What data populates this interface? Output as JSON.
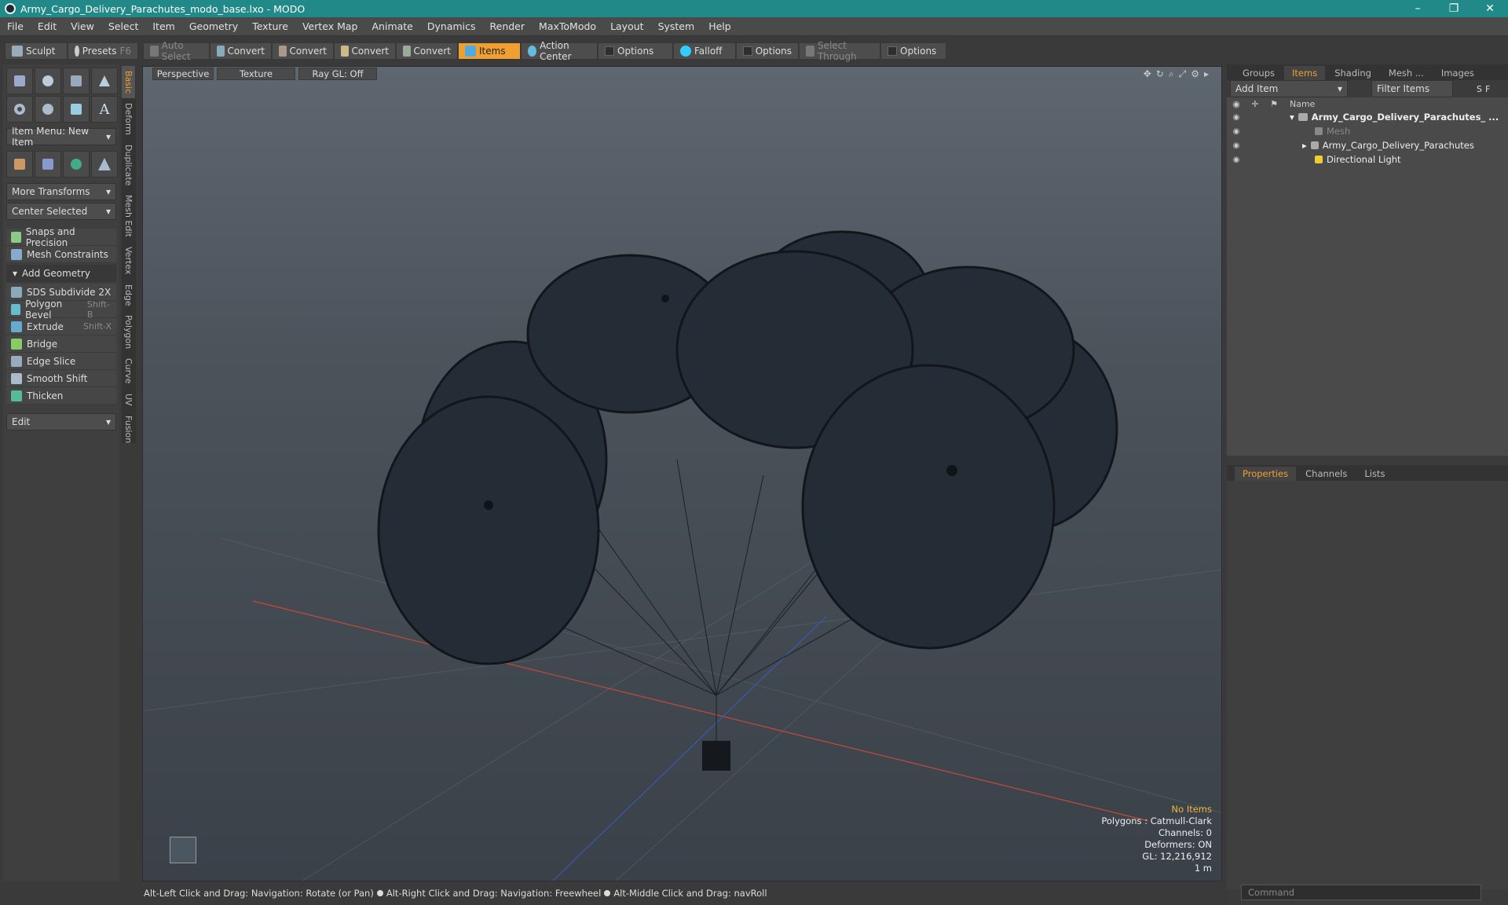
{
  "window": {
    "title": "Army_Cargo_Delivery_Parachutes_modo_base.lxo - MODO",
    "minimize": "–",
    "maximize": "❐",
    "close": "✕"
  },
  "menu": [
    "File",
    "Edit",
    "View",
    "Select",
    "Item",
    "Geometry",
    "Texture",
    "Vertex Map",
    "Animate",
    "Dynamics",
    "Render",
    "MaxToModo",
    "Layout",
    "System",
    "Help"
  ],
  "toolbar": {
    "sculpt": "Sculpt",
    "presets": "Presets",
    "presets_key": "F6",
    "auto_select": "Auto Select",
    "convert1": "Convert",
    "convert2": "Convert",
    "convert3": "Convert",
    "convert4": "Convert",
    "items": "Items",
    "action_center": "Action Center",
    "options1": "Options",
    "falloff": "Falloff",
    "options2": "Options",
    "select_through": "Select Through",
    "options3": "Options"
  },
  "left": {
    "item_menu": "Item Menu: New Item",
    "more_transforms": "More Transforms",
    "center_selected": "Center Selected",
    "snaps": "Snaps and Precision",
    "mesh_constraints": "Mesh Constraints",
    "add_geometry": "Add Geometry",
    "tools": [
      {
        "label": "SDS Subdivide 2X",
        "key": ""
      },
      {
        "label": "Polygon Bevel",
        "key": "Shift-B"
      },
      {
        "label": "Extrude",
        "key": "Shift-X"
      },
      {
        "label": "Bridge",
        "key": ""
      },
      {
        "label": "Edge Slice",
        "key": ""
      },
      {
        "label": "Smooth Shift",
        "key": ""
      },
      {
        "label": "Thicken",
        "key": ""
      }
    ],
    "edit": "Edit",
    "vtabs": [
      "Basic",
      "Deform",
      "Duplicate",
      "Mesh Edit",
      "Vertex",
      "Edge",
      "Polygon",
      "Curve",
      "UV",
      "Fusion"
    ]
  },
  "viewport": {
    "perspective": "Perspective",
    "texture": "Texture",
    "raygl": "Ray GL: Off",
    "info": {
      "no_items": "No Items",
      "polygons": "Polygons : Catmull-Clark",
      "channels": "Channels: 0",
      "deformers": "Deformers: ON",
      "gl": "GL: 12,216,912",
      "scale": "1 m"
    }
  },
  "status": {
    "hint1": "Alt-Left Click and Drag: Navigation: Rotate (or Pan)",
    "hint2": "Alt-Right Click and Drag: Navigation: Freewheel",
    "hint3": "Alt-Middle Click and Drag: navRoll"
  },
  "right": {
    "tabs": [
      "Groups",
      "Items",
      "Shading",
      "Mesh ...",
      "Images"
    ],
    "add_item": "Add Item",
    "filter_items": "Filter Items",
    "filter_s": "S",
    "filter_f": "F",
    "name_col": "Name",
    "tree": [
      {
        "label": "Army_Cargo_Delivery_Parachutes_ ...",
        "level": 0
      },
      {
        "label": "Mesh",
        "level": 1
      },
      {
        "label": "Army_Cargo_Delivery_Parachutes",
        "level": 1
      },
      {
        "label": "Directional Light",
        "level": 1
      }
    ],
    "ptabs": [
      "Properties",
      "Channels",
      "Lists"
    ],
    "command": "Command"
  }
}
